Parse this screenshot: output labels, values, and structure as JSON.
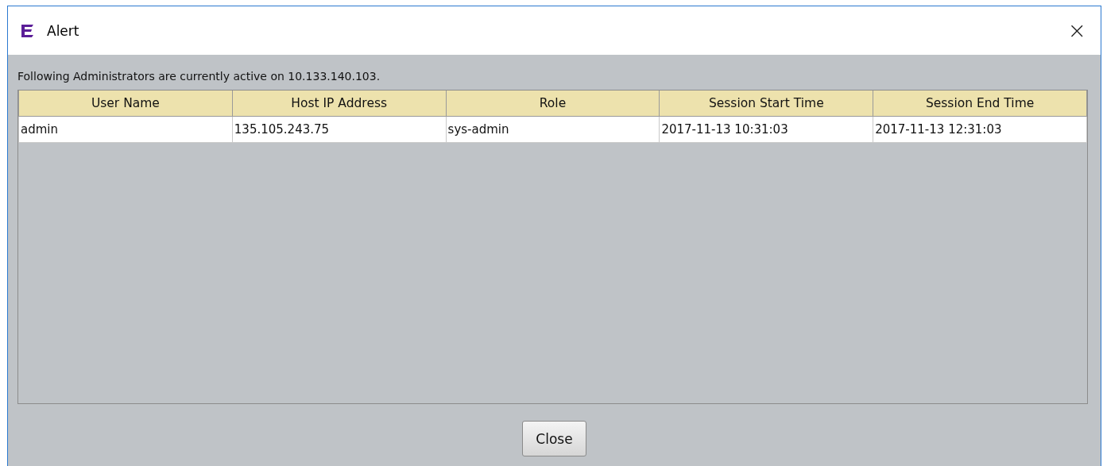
{
  "window": {
    "title": "Alert",
    "close_label": "×"
  },
  "message": "Following Administrators are currently active on 10.133.140.103.",
  "table": {
    "columns": [
      "User Name",
      "Host IP Address",
      "Role",
      "Session Start Time",
      "Session End Time"
    ],
    "rows": [
      [
        "admin",
        "135.105.243.75",
        "sys-admin",
        "2017-11-13 10:31:03",
        "2017-11-13 12:31:03"
      ]
    ]
  },
  "buttons": [
    "Close"
  ]
}
